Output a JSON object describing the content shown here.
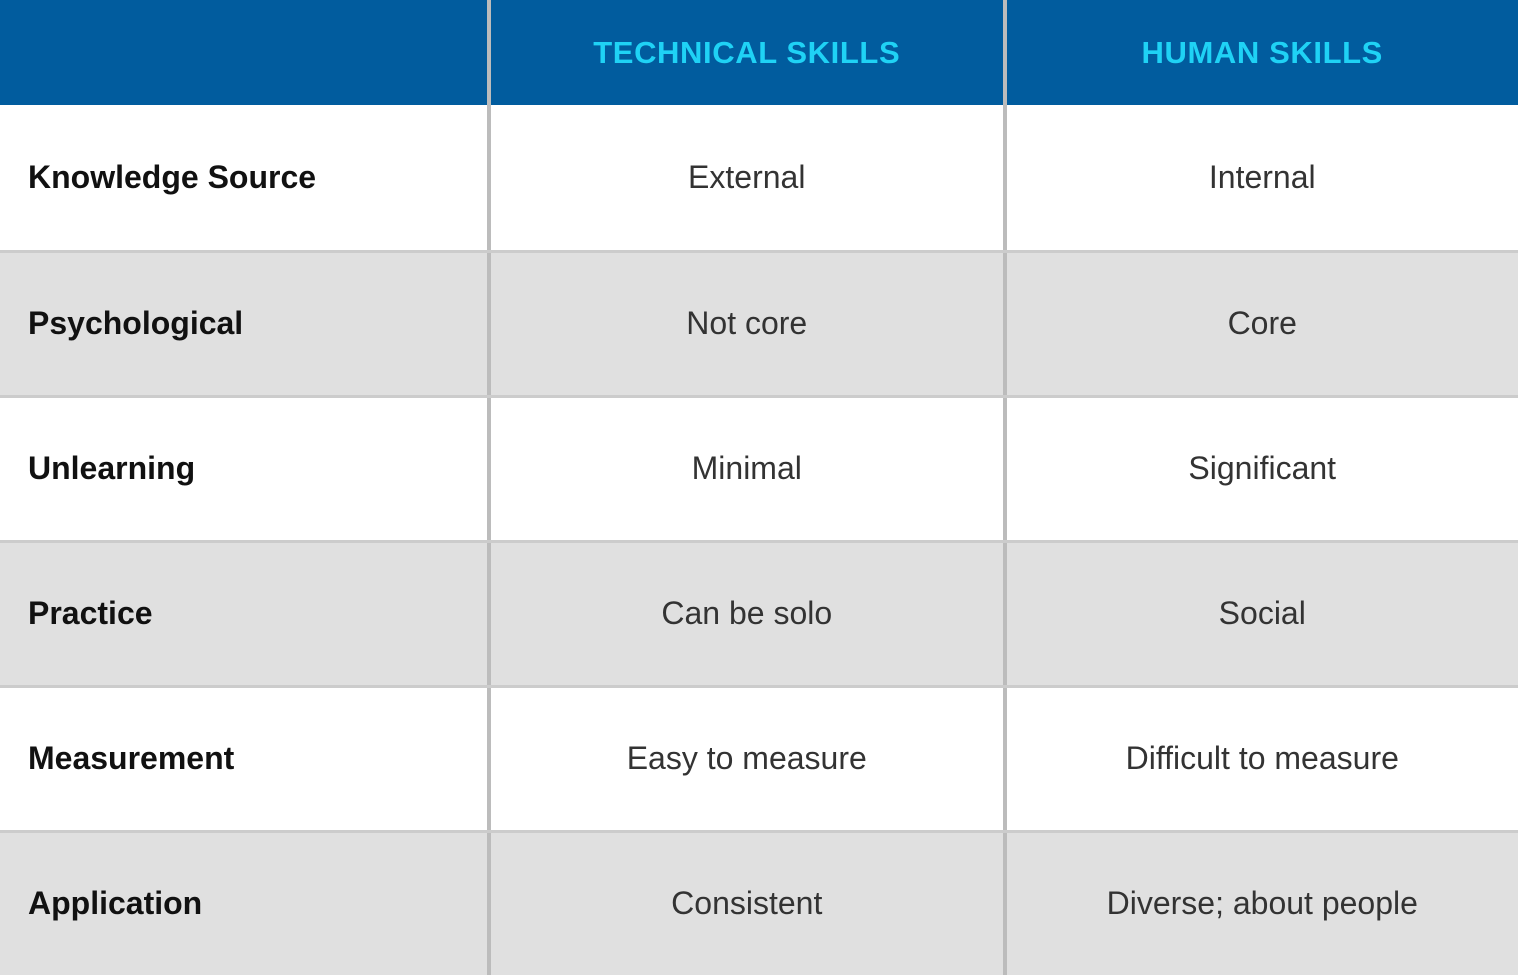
{
  "table": {
    "colors": {
      "header_background": "#015c9e",
      "header_text": "#1fd2f5",
      "row_shaded_background": "#e0e0e0",
      "row_plain_background": "#ffffff",
      "divider": "#bcbcbc",
      "row_separator": "#cccccc",
      "label_text": "#111111",
      "value_text": "#333333"
    },
    "columns": [
      {
        "id": "attribute",
        "label": ""
      },
      {
        "id": "technical_skills",
        "label": "TECHNICAL SKILLS"
      },
      {
        "id": "human_skills",
        "label": "HUMAN SKILLS"
      }
    ],
    "rows": [
      {
        "label": "Knowledge Source",
        "technical_skills": "External",
        "human_skills": "Internal",
        "shaded": false
      },
      {
        "label": "Psychological",
        "technical_skills": "Not core",
        "human_skills": "Core",
        "shaded": true
      },
      {
        "label": "Unlearning",
        "technical_skills": "Minimal",
        "human_skills": "Significant",
        "shaded": false
      },
      {
        "label": "Practice",
        "technical_skills": "Can be solo",
        "human_skills": "Social",
        "shaded": true
      },
      {
        "label": "Measurement",
        "technical_skills": "Easy to measure",
        "human_skills": "Difficult to measure",
        "shaded": false
      },
      {
        "label": "Application",
        "technical_skills": "Consistent",
        "human_skills": "Diverse; about people",
        "shaded": true
      }
    ]
  }
}
